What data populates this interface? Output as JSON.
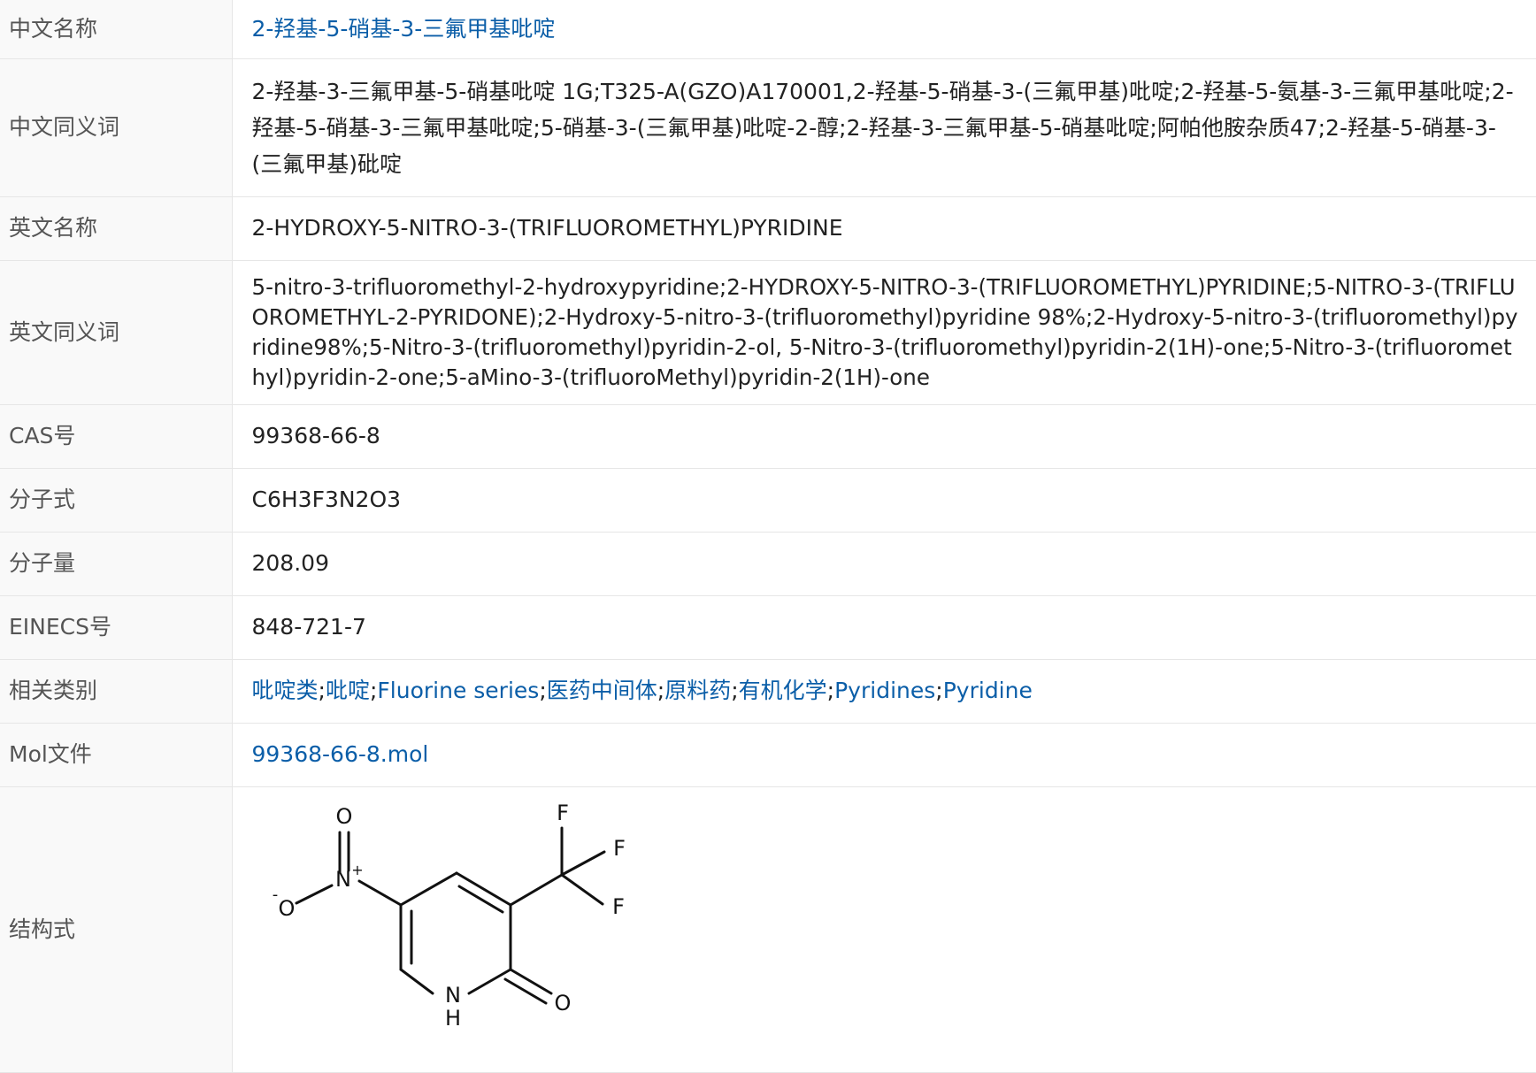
{
  "rows": {
    "cn_name": {
      "label": "中文名称",
      "value": "2-羟基-5-硝基-3-三氟甲基吡啶"
    },
    "cn_synonyms": {
      "label": "中文同义词",
      "value": "2-羟基-3-三氟甲基-5-硝基吡啶 1G;T325-A(GZO)A170001,2-羟基-5-硝基-3-(三氟甲基)吡啶;2-羟基-5-氨基-3-三氟甲基吡啶;2-羟基-5-硝基-3-三氟甲基吡啶;5-硝基-3-(三氟甲基)吡啶-2-醇;2-羟基-3-三氟甲基-5-硝基吡啶;阿帕他胺杂质47;2-羟基-5-硝基-3-(三氟甲基)砒啶"
    },
    "en_name": {
      "label": "英文名称",
      "value": "2-HYDROXY-5-NITRO-3-(TRIFLUOROMETHYL)PYRIDINE"
    },
    "en_synonyms": {
      "label": "英文同义词",
      "value": "5-nitro-3-trifluoromethyl-2-hydroxypyridine;2-HYDROXY-5-NITRO-3-(TRIFLUOROMETHYL)PYRIDINE;5-NITRO-3-(TRIFLUOROMETHYL-2-PYRIDONE);2-Hydroxy-5-nitro-3-(trifluoromethyl)pyridine 98%;2-Hydroxy-5-nitro-3-(trifluoromethyl)pyridine98%;5-Nitro-3-(trifluoromethyl)pyridin-2-ol, 5-Nitro-3-(trifluoromethyl)pyridin-2(1H)-one;5-Nitro-3-(trifluoromethyl)pyridin-2-one;5-aMino-3-(trifluoroMethyl)pyridin-2(1H)-one"
    },
    "cas": {
      "label": "CAS号",
      "value": "99368-66-8"
    },
    "formula": {
      "label": "分子式",
      "value": "C6H3F3N2O3"
    },
    "mw": {
      "label": "分子量",
      "value": "208.09"
    },
    "einecs": {
      "label": "EINECS号",
      "value": "848-721-7"
    },
    "category": {
      "label": "相关类别",
      "items": [
        "吡啶类",
        "吡啶",
        "Fluorine series",
        "医药中间体",
        "原料药",
        "有机化学",
        "Pyridines",
        "Pyridine"
      ],
      "separator": ";"
    },
    "mol": {
      "label": "Mol文件",
      "value": "99368-66-8.mol"
    },
    "structure": {
      "label": "结构式",
      "atoms": {
        "o_top": "O",
        "n_nitro": "N",
        "n_plus": "+",
        "o_minus_sign": "-",
        "o_minus": "O",
        "f1": "F",
        "f2": "F",
        "f3": "F",
        "nh_n": "N",
        "nh_h": "H",
        "o_keto": "O"
      }
    }
  },
  "colors": {
    "link": "#0b5ea8",
    "label_bg": "#f9f9f9",
    "border": "#e6e6e6",
    "label_text": "#555555"
  }
}
